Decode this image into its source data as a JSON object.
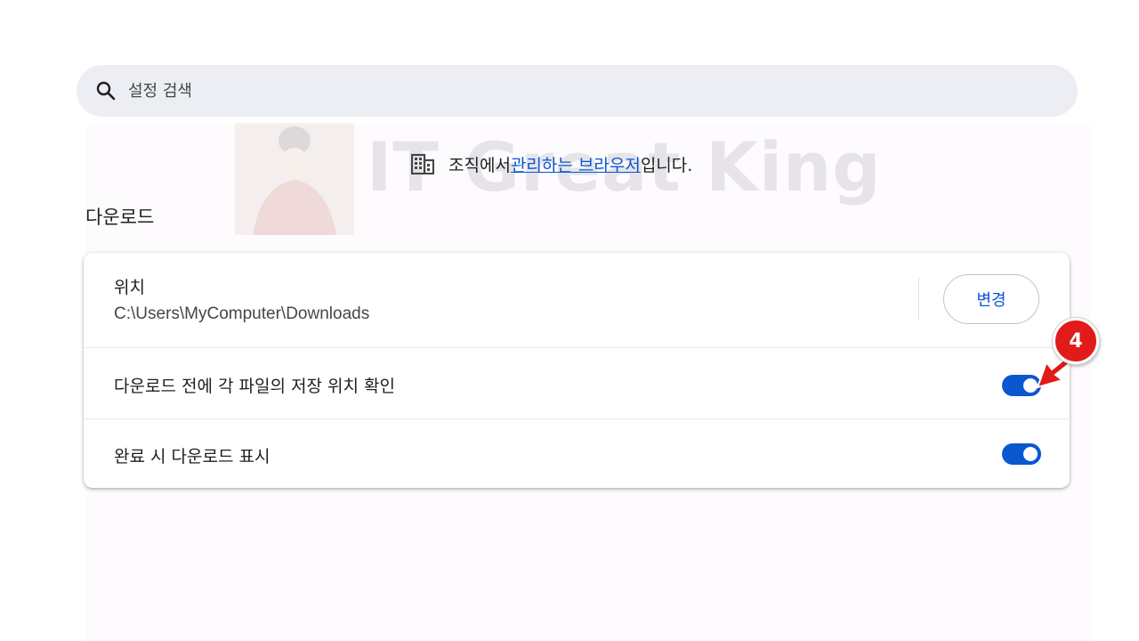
{
  "search": {
    "placeholder": "설정 검색",
    "icon": "search-icon"
  },
  "watermark": {
    "text": "IT Great King"
  },
  "managed_notice": {
    "icon": "building-icon",
    "prefix": "조직에서 ",
    "link_text": "관리하는 브라우저",
    "suffix": "입니다."
  },
  "downloads": {
    "section_title": "다운로드",
    "location": {
      "label": "위치",
      "path": "C:\\Users\\MyComputer\\Downloads",
      "change_button": "변경"
    },
    "ask_where_to_save": {
      "label": "다운로드 전에 각 파일의 저장 위치 확인",
      "enabled": true
    },
    "show_when_complete": {
      "label": "완료 시 다운로드 표시",
      "enabled": true
    }
  },
  "annotation": {
    "badge": "4",
    "color": "#e11a1a"
  },
  "colors": {
    "accent": "#0b57d0",
    "search_bg": "#edeef4"
  }
}
